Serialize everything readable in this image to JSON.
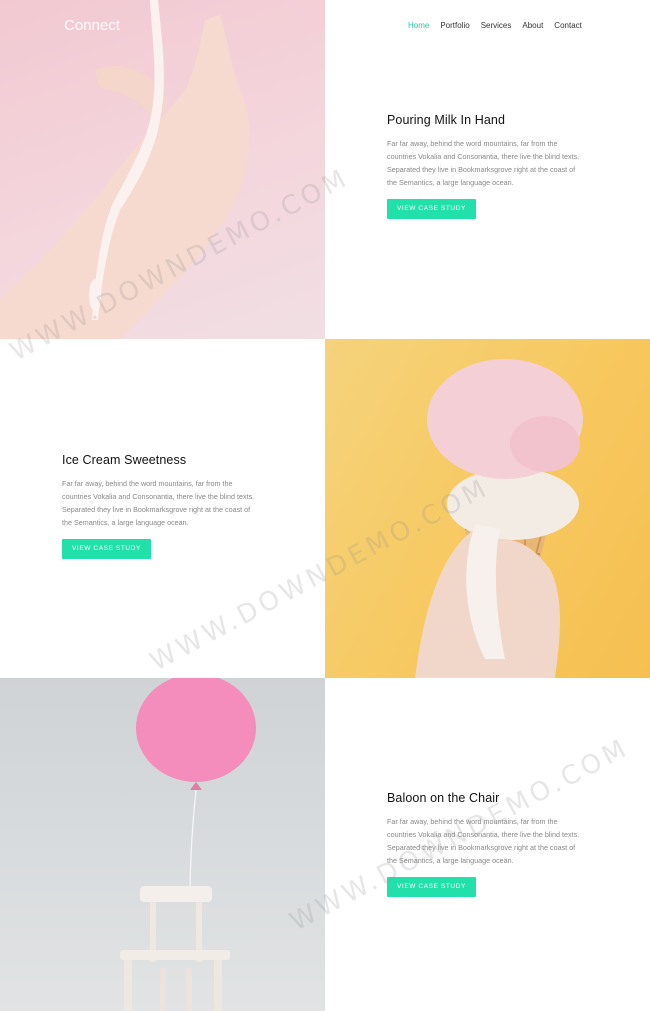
{
  "header": {
    "logo": "Connect",
    "nav": [
      "Home",
      "Portfolio",
      "Services",
      "About",
      "Contact"
    ],
    "active_nav": "Home"
  },
  "projects": [
    {
      "title": "Pouring Milk In Hand",
      "description": "Far far away, behind the word mountains, far from the countries Vokalia and Consonantia, there live the blind texts. Separated they live in Bookmarksgrove right at the coast of the Semantics, a large language ocean.",
      "button": "VIEW CASE STUDY",
      "image": "milk-hand-photo"
    },
    {
      "title": "Ice Cream Sweetness",
      "description": "Far far away, behind the word mountains, far from the countries Vokalia and Consonantia, there live the blind texts. Separated they live in Bookmarksgrove right at the coast of the Semantics, a large language ocean.",
      "button": "VIEW CASE STUDY",
      "image": "ice-cream-photo"
    },
    {
      "title": "Baloon on the Chair",
      "description": "Far far away, behind the word mountains, far from the countries Vokalia and Consonantia, there live the blind texts. Separated they live in Bookmarksgrove right at the coast of the Semantics, a large language ocean.",
      "button": "VIEW CASE STUDY",
      "image": "balloon-chair-photo"
    }
  ],
  "watermark": "WWW.DOWNDEMO.COM",
  "colors": {
    "accent": "#22e0aa",
    "active_nav": "#22c9a0"
  }
}
